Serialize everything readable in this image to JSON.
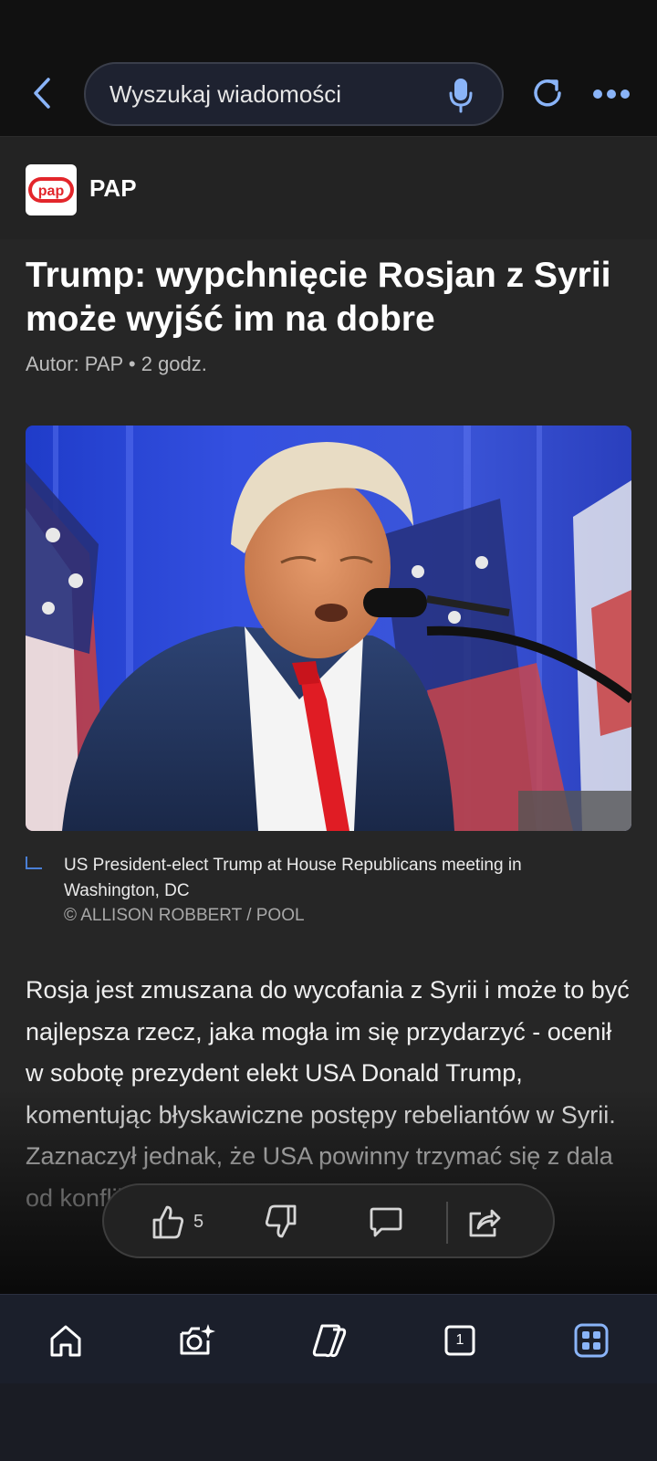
{
  "search": {
    "placeholder": "Wyszukaj wiadomości"
  },
  "publisher": {
    "logo_text": "pap",
    "name": "PAP"
  },
  "article": {
    "title": "Trump: wypchnięcie Rosjan z Syrii może wyjść im na dobre",
    "byline": "Autor: PAP • 2 godz.",
    "image_caption": "US President-elect Trump at House Republicans meeting in Washington, DC",
    "image_credit": "© ALLISON ROBBERT / POOL",
    "body": "Rosja jest zmuszana do wycofania z Syrii i może to być najlepsza rzecz, jaka mogła im się przydarzyć - ocenił w sobotę prezydent elekt USA Donald Trump, komentując błyskawiczne postępy rebeliantów w Syrii. Zaznaczył jednak, że USA powinny trzymać się z dala od konfliktu w Syrii."
  },
  "actions": {
    "like_count": "5"
  },
  "bottom_nav": {
    "tab_count": "1"
  },
  "colors": {
    "accent": "#8ab4f8",
    "background": "#262626"
  },
  "icons": [
    "back-arrow-icon",
    "microphone-icon",
    "refresh-icon",
    "more-dots-icon",
    "thumbs-up-icon",
    "thumbs-down-icon",
    "comment-icon",
    "share-icon",
    "home-icon",
    "camera-sparkle-icon",
    "copilot-icon",
    "tabs-icon",
    "apps-grid-icon"
  ]
}
